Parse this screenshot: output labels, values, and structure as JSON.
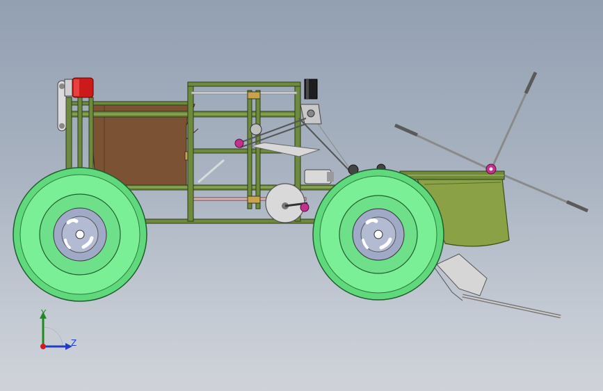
{
  "viewport": {
    "background_top": "#93a0b2",
    "background_bottom": "#cfd3d9"
  },
  "triad": {
    "y_label": "Y",
    "z_label": "Z",
    "y_color": "#1f8a1f",
    "z_color": "#1e3fc4",
    "x_color": "#d01c1c"
  },
  "model": {
    "tire_color": "#6ee88a",
    "hub_color": "#9aa6c8",
    "frame_color": "#6e8b3d",
    "hopper_color": "#7a5234",
    "motor_color": "#cc1a1a",
    "tray_color": "#7f9a3c"
  }
}
